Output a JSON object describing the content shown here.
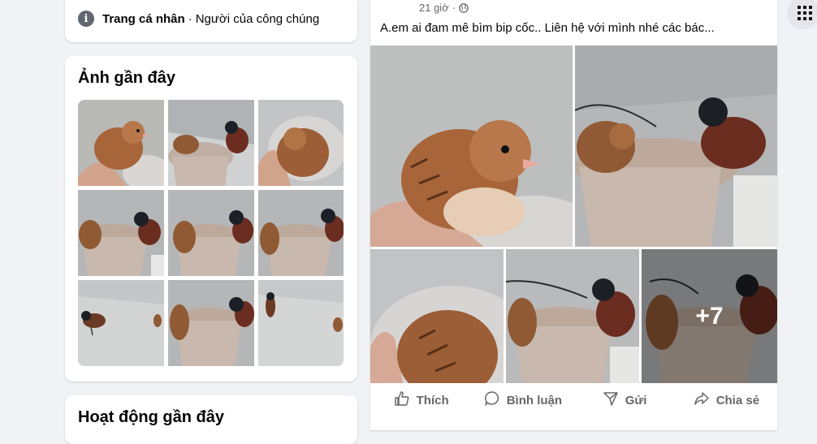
{
  "intro": {
    "label": "Trang cá nhân",
    "separator": "·",
    "value": "Người của công chúng",
    "icon": "info-icon"
  },
  "photos": {
    "title": "Ảnh gần đây"
  },
  "activity": {
    "title": "Hoạt động gần đây"
  },
  "post": {
    "time": "21 giờ",
    "privacy_icon": "globe-icon",
    "text": "A.em ai đam mê bìm bip cốc.. Liên hệ với mình nhé các bác...",
    "more_photos": "+7",
    "actions": {
      "like": "Thích",
      "comment": "Bình luận",
      "send": "Gửi",
      "share": "Chia sẻ"
    }
  },
  "menu": {
    "icon": "apps-grid-icon"
  },
  "colors": {
    "background": "#f0f2f5",
    "card": "#ffffff",
    "secondary_text": "#65676b",
    "bird_chick": "#a8653a",
    "bird_adult_head": "#1c1f26",
    "bird_adult_wing": "#6b2d1f",
    "bucket": "#c9b8ad"
  }
}
